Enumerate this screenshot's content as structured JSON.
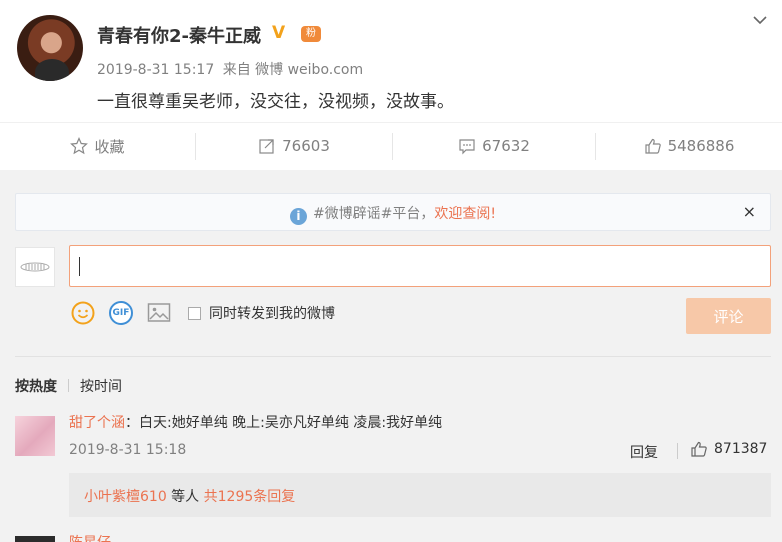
{
  "post": {
    "author": "青春有你2-秦牛正威",
    "verified_glyph": "V",
    "medal_glyph": "粉",
    "date": "2019-8-31 15:17",
    "source_prefix": "来自",
    "source": "微博 weibo.com",
    "text": "一直很尊重吴老师，没交往，没视频，没故事。"
  },
  "actions": {
    "favorite": "收藏",
    "reposts": "76603",
    "comments": "67632",
    "likes": "5486886"
  },
  "notice": {
    "text": "#微博辟谣#平台，",
    "link": "欢迎查阅!",
    "close": "×"
  },
  "composer": {
    "input_value": "",
    "forward_label": "同时转发到我的微博",
    "submit_label": "评论",
    "gif_label": "GIF"
  },
  "sort": {
    "hot": "按热度",
    "time": "按时间"
  },
  "comments": [
    {
      "user": "甜了个涵",
      "text": "：白天:她好单纯 晚上:吴亦凡好单纯 凌晨:我好单纯",
      "date": "2019-8-31 15:18",
      "reply_label": "回复",
      "likes": "871387",
      "sub_user": "小叶紫檀610",
      "sub_mid": " 等人 ",
      "sub_count": "共1295条回复"
    }
  ],
  "partial_next_user": "陈星仔",
  "colors": {
    "accent": "#eb7350",
    "panel_bg": "#f2f2f2",
    "button_disabled": "#f7c8a8"
  }
}
